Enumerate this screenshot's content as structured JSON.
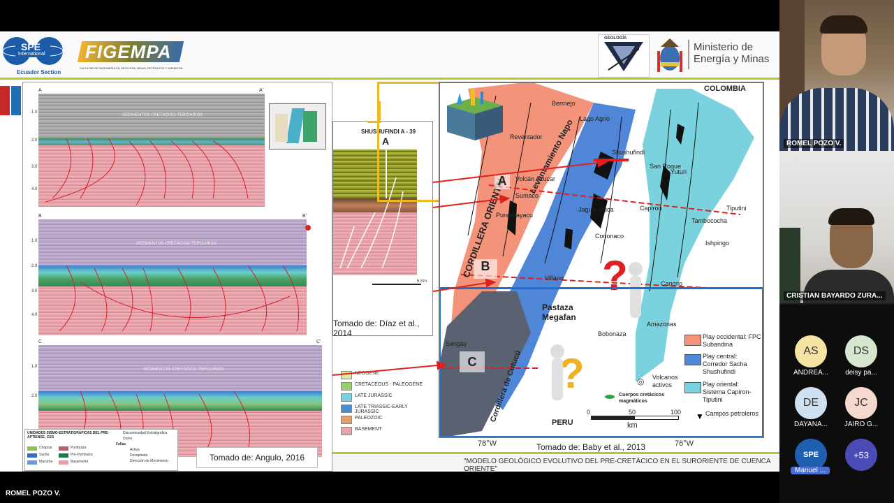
{
  "presenter": {
    "name": "ROMEL POZO V."
  },
  "slide": {
    "logos": {
      "spe": "SPE",
      "spe_sub": "International",
      "spe_section": "Ecuador Section",
      "figempa": "FIGEMPA",
      "figempa_sub": "FACULTAD DE INGENIERÍA EN GEOLOGÍA, MINAS, PETRÓLEOS Y AMBIENTAL",
      "geologia": "GEOLOGÍA",
      "ministry": "Ministerio de\nEnergía y Minas"
    },
    "footer_title": "\"MODELO GEOLÓGICO EVOLUTIVO DEL PRE-CRETÁCICO EN EL SURORIENTE DE CUENCA ORIENTE\"",
    "left_panel": {
      "section_a": {
        "start": "A",
        "end": "A'",
        "label": "SEDIMENTOS CRETÁCICO-TERCIARIOS"
      },
      "section_b": {
        "start": "B",
        "end": "B'",
        "label": "SEDIMENTOS CRETÁCICO-TERCIARIOS"
      },
      "section_c": {
        "start": "C",
        "end": "C'",
        "label": "SEDIMENTOS CRETÁCICO-TERCIARIOS"
      },
      "twt_ticks": [
        "1.0",
        "2.0",
        "3.0",
        "4.0"
      ],
      "legend_title": "UNIDADES SISMO-ESTRATIGRÁFICAS DEL PRE-APTIENSE, CSS",
      "legend_units": [
        "Chapiza",
        "Pumbuiza",
        "Sacha",
        "Pre-Pumbuiza",
        "Macuma",
        "Basamento"
      ],
      "legend_lines": [
        "Discontinuidad Estratigráfica",
        "Domo",
        "Fallas",
        "Activa",
        "Decapitada",
        "Dirección de Movimiento"
      ],
      "credit": "Tomado de: Angulo, 2016"
    },
    "middle_panel": {
      "well": "SHUSHUFINDI A - 39",
      "well_marker": "A",
      "scale": "5 Km",
      "credit": "Tomado de: Díaz et al., 2014",
      "legend": [
        "NEOGENE",
        "CRETACEOUS - PALEOGENE",
        "LATE JURASSIC",
        "LATE TRIASSIC-EARLY JURASSIC",
        "PALEOZOIC",
        "BASEMENT"
      ]
    },
    "map": {
      "country_top": "COLOMBIA",
      "country_bottom": "PERU",
      "places": [
        "Bermejo",
        "Lago Agrio",
        "Reventador",
        "Shushufindi",
        "San Roque",
        "Yuturi",
        "Jaguar",
        "Auca",
        "Capiron",
        "Tiputini",
        "Tambococha",
        "Ishpingo",
        "Pungarayacu",
        "Cononaco",
        "Villano",
        "Cancrio",
        "Amazonas",
        "Bobonaza",
        "Sangay",
        "Sumaco",
        "Volcán Azucar"
      ],
      "regions": [
        "Levantamiento Napo",
        "CORDILLERA ORIENTAL",
        "Pastaza Megafan",
        "Cordillera de Cutucú"
      ],
      "markers": [
        "A",
        "B",
        "C"
      ],
      "legend": [
        {
          "label": "Play occidental: FPC Subandina",
          "color": "#f2937a"
        },
        {
          "label": "Play central: Corredor Sacha Shushufindi",
          "color": "#4f86d8"
        },
        {
          "label": "Play oriental: Sistema Capiron-Tiputini",
          "color": "#79d2dd"
        }
      ],
      "extra_legend": [
        "Volcanos activos",
        "Cuerpos cretácicos magmáticos",
        "Campos petroleros"
      ],
      "scale_ticks": [
        "0",
        "50",
        "100"
      ],
      "scale_unit": "km",
      "lon_ticks": [
        "78°W",
        "76°W"
      ],
      "credit": "Tomado de: Baby et al., 2013"
    }
  },
  "participants": {
    "video": [
      {
        "name": "ROMEL POZO V."
      },
      {
        "name": "CRISTIAN BAYARDO ZURA..."
      }
    ],
    "avatars": [
      {
        "initials": "AS",
        "name": "ANDREA...",
        "color": "#f5e3a3"
      },
      {
        "initials": "DS",
        "name": "deisy pa...",
        "color": "#d5e8cf"
      },
      {
        "initials": "DE",
        "name": "DAYANA...",
        "color": "#cfe0f0"
      },
      {
        "initials": "JC",
        "name": "JAIRO G...",
        "color": "#f6d9cc"
      },
      {
        "initials": "SPE",
        "name": "Manuel ...",
        "color": "#1f5fb0"
      },
      {
        "initials": "+53",
        "name": "",
        "color": "#4b4bb8"
      }
    ]
  }
}
